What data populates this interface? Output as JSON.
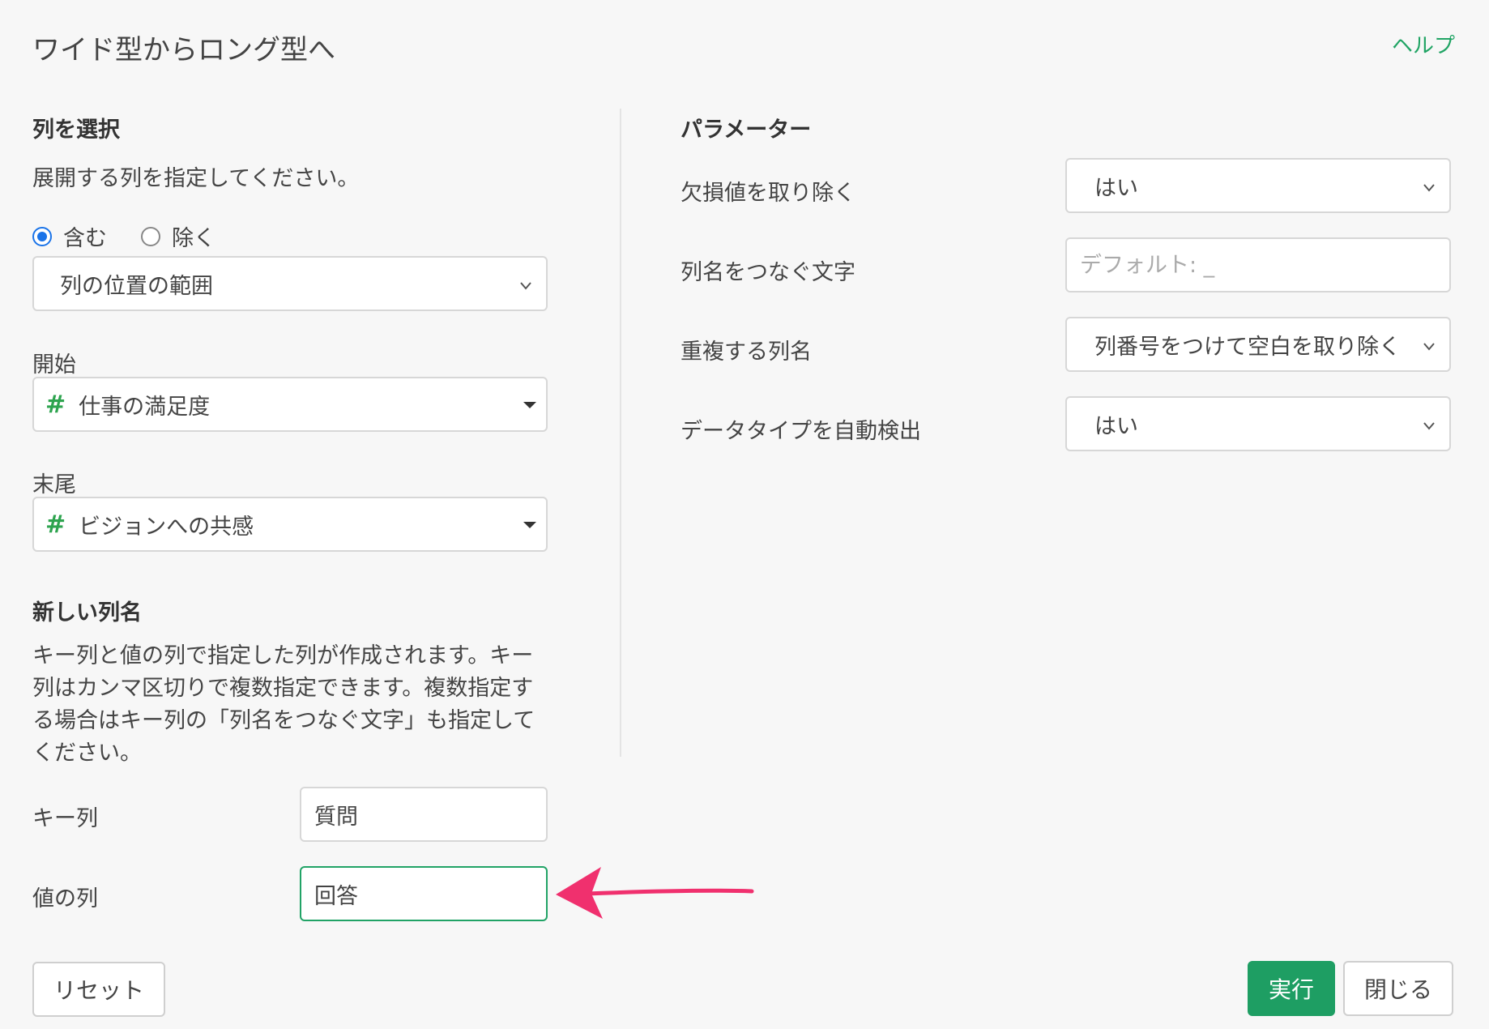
{
  "dialog": {
    "title": "ワイド型からロング型へ",
    "help_label": "ヘルプ"
  },
  "select_columns": {
    "heading": "列を選択",
    "description": "展開する列を指定してください。",
    "radio_include": "含む",
    "radio_exclude": "除く",
    "selected_mode": "含む",
    "method_value": "列の位置の範囲",
    "start_label": "開始",
    "start_value": "仕事の満足度",
    "end_label": "末尾",
    "end_value": "ビジョンへの共感"
  },
  "new_column_names": {
    "heading": "新しい列名",
    "description": "キー列と値の列で指定した列が作成されます。キー列はカンマ区切りで複数指定できます。複数指定する場合はキー列の「列名をつなぐ文字」も指定してください。",
    "key_label": "キー列",
    "key_value": "質問",
    "value_label": "値の列",
    "value_value": "回答"
  },
  "parameters": {
    "heading": "パラメーター",
    "drop_na_label": "欠損値を取り除く",
    "drop_na_value": "はい",
    "sep_label": "列名をつなぐ文字",
    "sep_placeholder": "デフォルト: _",
    "dup_label": "重複する列名",
    "dup_value": "列番号をつけて空白を取り除く",
    "convert_label": "データタイプを自動検出",
    "convert_value": "はい"
  },
  "footer": {
    "reset_label": "リセット",
    "run_label": "実行",
    "close_label": "閉じる"
  },
  "colors": {
    "accent": "#1e9e63",
    "radio": "#1a73e8",
    "annotation_arrow": "#f0306e"
  },
  "icons": {
    "chevron": "chevron-down-icon",
    "caret": "caret-down-icon",
    "number_type": "hash-icon"
  }
}
